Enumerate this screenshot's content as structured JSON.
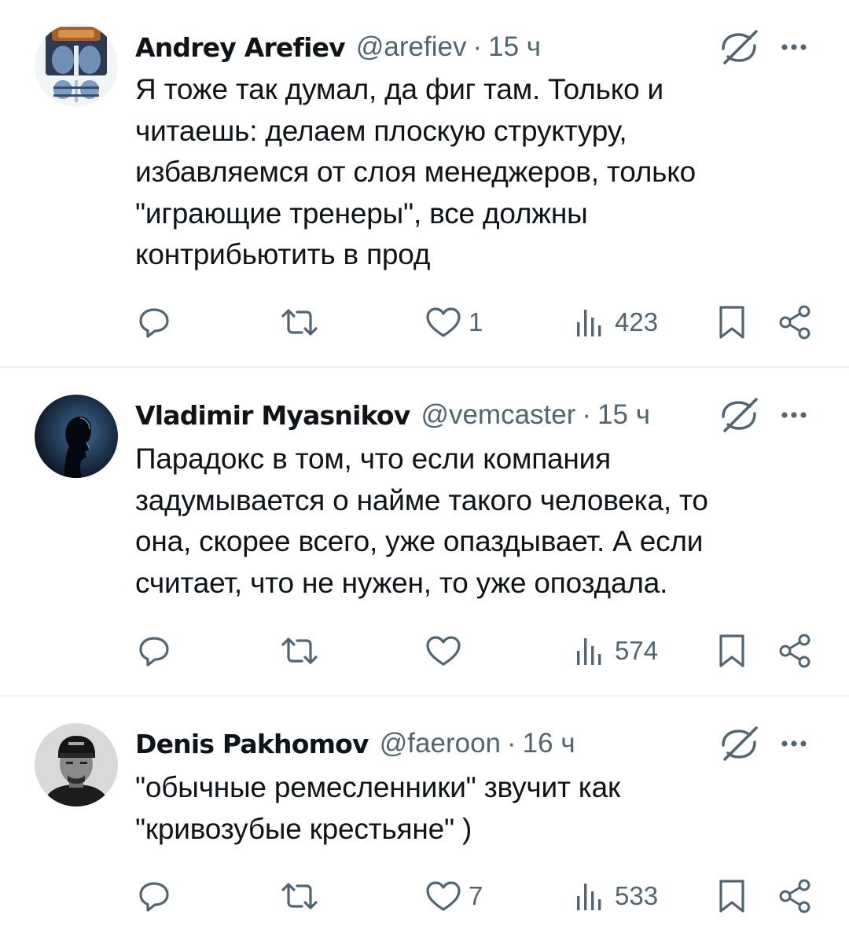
{
  "posts": [
    {
      "author": "Andrey Arefiev",
      "handle": "@arefiev",
      "separator": "·",
      "time": "15 ч",
      "text": "Я тоже так думал, да фиг там. Только и\nчитаешь: делаем плоскую структуру,\nизбавляемся от слоя менеджеров, только\n\"играющие тренеры\", все должны\nконтрибьютить в прод",
      "likes": "1",
      "views": "423"
    },
    {
      "author": "Vladimir Myasnikov",
      "handle": "@vemcaster",
      "separator": "·",
      "time": "15 ч",
      "text": "Парадокс в том, что если компания\nзадумывается о найме такого человека, то\nона, скорее всего, уже опаздывает. А если\nсчитает, что не нужен, то уже опоздала.",
      "likes": "",
      "views": "574"
    },
    {
      "author": "Denis Pakhomov",
      "handle": "@faeroon",
      "separator": "·",
      "time": "16 ч",
      "text": "\"обычные ремесленники\" звучит как\n\"кривозубые крестьяне\" )",
      "likes": "7",
      "views": "533"
    }
  ],
  "icons": {
    "reply": "reply-icon",
    "repost": "repost-icon",
    "like": "heart-icon",
    "views": "views-icon",
    "bookmark": "bookmark-icon",
    "share": "share-icon",
    "grok": "grok-icon",
    "more": "more-icon"
  },
  "colors": {
    "text": "#0f1419",
    "secondary": "#536471",
    "divider": "#eff3f4",
    "background": "#ffffff"
  }
}
